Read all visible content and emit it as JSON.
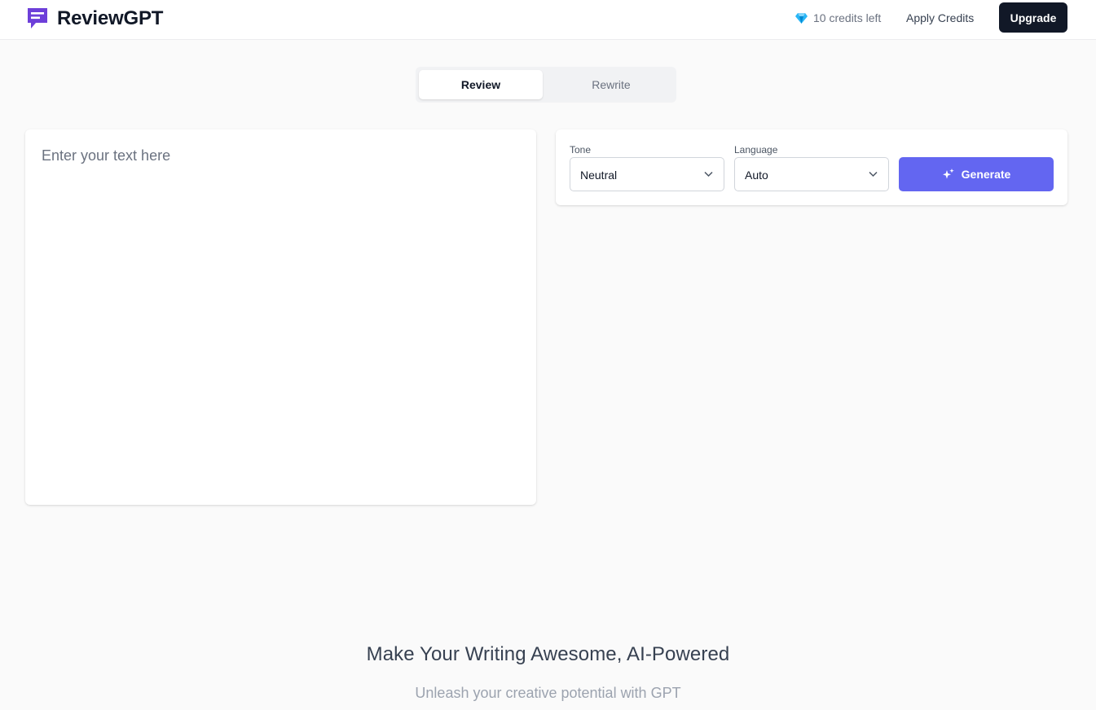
{
  "header": {
    "brand_name": "ReviewGPT",
    "credits_text": "10 credits left",
    "apply_credits_label": "Apply Credits",
    "upgrade_label": "Upgrade"
  },
  "tabs": [
    {
      "label": "Review",
      "active": true
    },
    {
      "label": "Rewrite",
      "active": false
    }
  ],
  "editor": {
    "placeholder": "Enter your text here",
    "value": ""
  },
  "controls": {
    "tone": {
      "label": "Tone",
      "selected": "Neutral"
    },
    "language": {
      "label": "Language",
      "selected": "Auto"
    },
    "generate_label": "Generate"
  },
  "hero": {
    "title": "Make Your Writing Awesome, AI-Powered",
    "subtitle": "Unleash your creative potential with GPT"
  },
  "colors": {
    "accent": "#6366f1",
    "brand_icon": "#6d3fd9",
    "upgrade_bg": "#111827",
    "gem": "#29b6f6"
  },
  "icons": {
    "brand": "chat-bubble-lines-icon",
    "credits": "gem-icon",
    "select": "chevron-down-icon",
    "generate": "sparkles-icon"
  }
}
